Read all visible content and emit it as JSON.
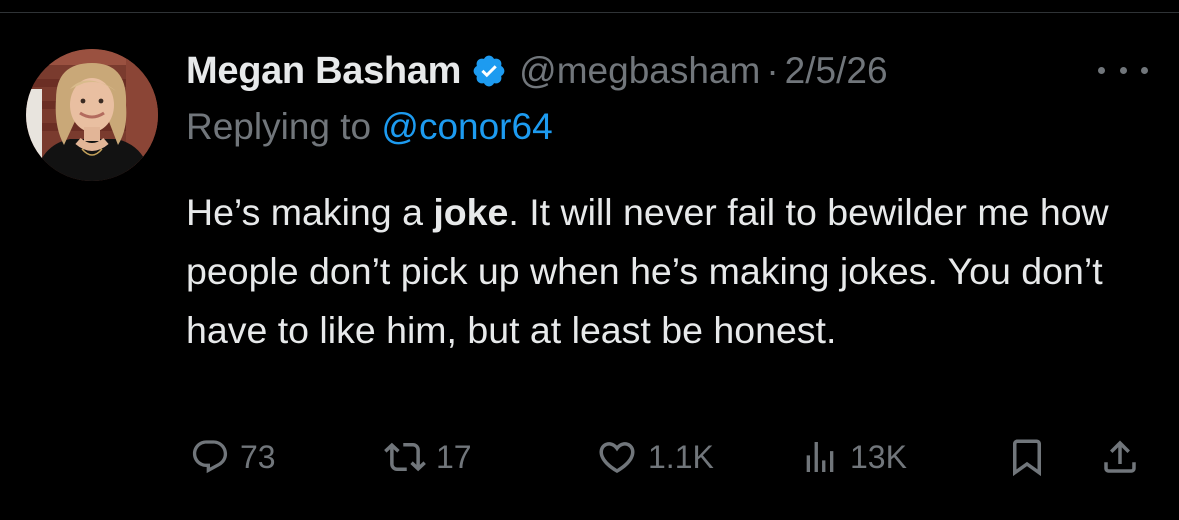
{
  "tweet": {
    "author_name": "Megan Basham",
    "handle": "@megbasham",
    "separator": "·",
    "date": "2/5/26",
    "reply_label": "Replying to ",
    "reply_to": "@conor64",
    "text_before_bold": "He’s making a ",
    "text_bold": "joke",
    "text_after_bold": ". It will never fail to bewilder me how people don’t pick up when he’s making jokes. You don’t have to like him, but at least be honest.",
    "metrics": {
      "replies": "73",
      "reposts": "17",
      "likes": "1.1K",
      "views": "13K"
    }
  },
  "icons": {
    "verified": "verified-badge-icon",
    "more": "more-options-icon",
    "reply": "reply-icon",
    "repost": "repost-icon",
    "like": "like-icon",
    "views": "views-icon",
    "bookmark": "bookmark-icon",
    "share": "share-icon"
  },
  "colors": {
    "background": "#000000",
    "primary_text": "#e7e9ea",
    "secondary_text": "#71767b",
    "accent": "#1d9bf0"
  }
}
